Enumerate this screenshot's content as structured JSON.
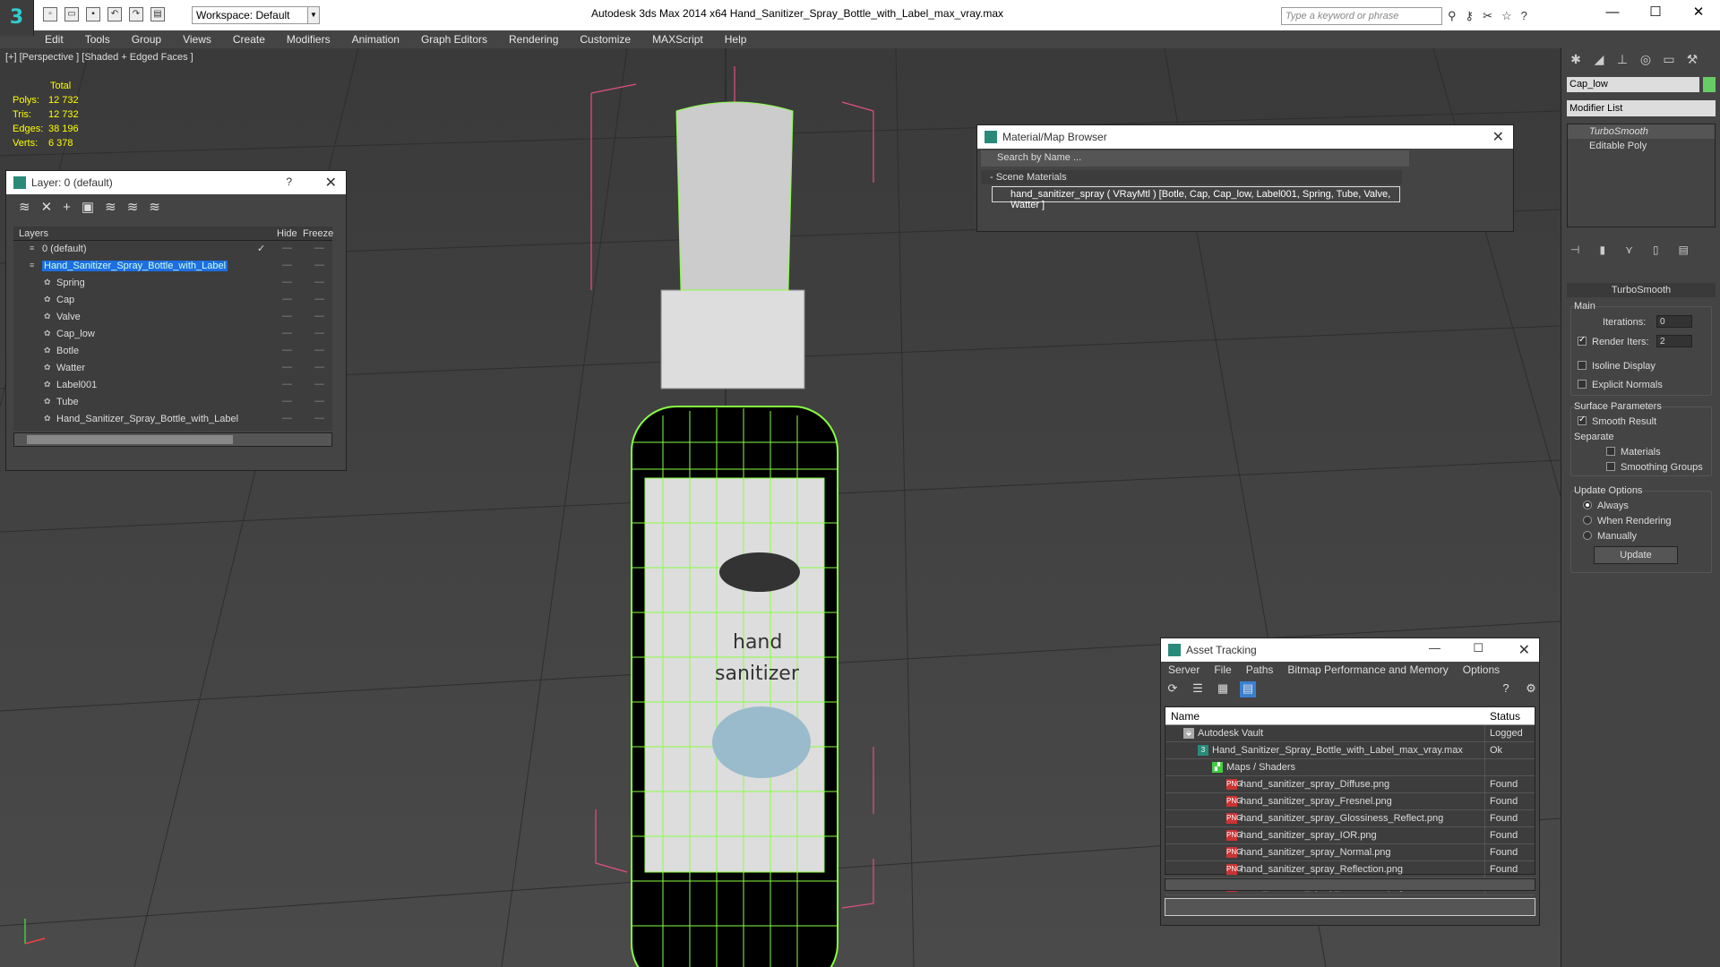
{
  "app": {
    "logo": "3",
    "title": "Autodesk 3ds Max  2014 x64      Hand_Sanitizer_Spray_Bottle_with_Label_max_vray.max",
    "workspace": "Workspace: Default",
    "search_placeholder": "Type a keyword or phrase",
    "window_controls": [
      "—",
      "☐",
      "✕"
    ]
  },
  "menu": [
    "Edit",
    "Tools",
    "Group",
    "Views",
    "Create",
    "Modifiers",
    "Animation",
    "Graph Editors",
    "Rendering",
    "Customize",
    "MAXScript",
    "Help"
  ],
  "viewport": {
    "label": "[+] [Perspective ] [Shaded + Edged Faces ]",
    "stats": {
      "header": "Total",
      "rows": [
        {
          "k": "Polys:",
          "v": "12 732"
        },
        {
          "k": "Tris:",
          "v": "12 732"
        },
        {
          "k": "Edges:",
          "v": "38 196"
        },
        {
          "k": "Verts:",
          "v": "6 378"
        }
      ]
    },
    "label_texts": [
      "hand",
      "sanitizer"
    ]
  },
  "layer_panel": {
    "title": "Layer: 0 (default)",
    "help": "?",
    "close": "✕",
    "columns": {
      "layers": "Layers",
      "hide": "Hide",
      "freeze": "Freeze"
    },
    "rows": [
      {
        "name": "0 (default)",
        "indent": 0,
        "selected": false,
        "check": true
      },
      {
        "name": "Hand_Sanitizer_Spray_Bottle_with_Label",
        "indent": 0,
        "selected": true,
        "check": false
      },
      {
        "name": "Spring",
        "indent": 1,
        "selected": false,
        "check": false
      },
      {
        "name": "Cap",
        "indent": 1,
        "selected": false,
        "check": false
      },
      {
        "name": "Valve",
        "indent": 1,
        "selected": false,
        "check": false
      },
      {
        "name": "Cap_low",
        "indent": 1,
        "selected": false,
        "check": false
      },
      {
        "name": "Botle",
        "indent": 1,
        "selected": false,
        "check": false
      },
      {
        "name": "Watter",
        "indent": 1,
        "selected": false,
        "check": false
      },
      {
        "name": "Label001",
        "indent": 1,
        "selected": false,
        "check": false
      },
      {
        "name": "Tube",
        "indent": 1,
        "selected": false,
        "check": false
      },
      {
        "name": "Hand_Sanitizer_Spray_Bottle_with_Label",
        "indent": 1,
        "selected": false,
        "check": false
      }
    ]
  },
  "material_browser": {
    "title": "Material/Map Browser",
    "close": "✕",
    "search": "Search by Name ...",
    "section": "- Scene Materials",
    "item": "hand_sanitizer_spray  ( VRayMtl ) [Botle, Cap, Cap_low, Label001, Spring, Tube, Valve, Watter ]"
  },
  "command_panel": {
    "object_name": "Cap_low",
    "object_color": "#66cc66",
    "modifier_list": "Modifier List",
    "stack": [
      "TurboSmooth",
      "Editable Poly"
    ],
    "rollout": "TurboSmooth",
    "main": "Main",
    "iterations_label": "Iterations:",
    "iterations": "0",
    "render_iters_label": "Render Iters:",
    "render_iters": "2",
    "render_iters_checked": true,
    "isoline": "Isoline Display",
    "explicit": "Explicit Normals",
    "surface": "Surface Parameters",
    "smooth_result": "Smooth Result",
    "separate": "Separate",
    "materials": "Materials",
    "smoothing_groups": "Smoothing Groups",
    "update_options": "Update Options",
    "always": "Always",
    "when_rendering": "When Rendering",
    "manually": "Manually",
    "update_btn": "Update"
  },
  "asset_tracking": {
    "title": "Asset Tracking",
    "controls": [
      "—",
      "☐",
      "✕"
    ],
    "menu": [
      "Server",
      "File",
      "Paths",
      "Bitmap Performance and Memory",
      "Options"
    ],
    "columns": {
      "name": "Name",
      "status": "Status"
    },
    "rows": [
      {
        "name": "Autodesk Vault",
        "status": "Logged",
        "indent": 1,
        "icon": "vault"
      },
      {
        "name": "Hand_Sanitizer_Spray_Bottle_with_Label_max_vray.max",
        "status": "Ok",
        "indent": 2,
        "icon": "max"
      },
      {
        "name": "Maps / Shaders",
        "status": "",
        "indent": 3,
        "icon": "maps"
      },
      {
        "name": "hand_sanitizer_spray_Diffuse.png",
        "status": "Found",
        "indent": 4,
        "icon": "png"
      },
      {
        "name": "hand_sanitizer_spray_Fresnel.png",
        "status": "Found",
        "indent": 4,
        "icon": "png"
      },
      {
        "name": "hand_sanitizer_spray_Glossiness_Reflect.png",
        "status": "Found",
        "indent": 4,
        "icon": "png"
      },
      {
        "name": "hand_sanitizer_spray_IOR.png",
        "status": "Found",
        "indent": 4,
        "icon": "png"
      },
      {
        "name": "hand_sanitizer_spray_Normal.png",
        "status": "Found",
        "indent": 4,
        "icon": "png"
      },
      {
        "name": "hand_sanitizer_spray_Reflection.png",
        "status": "Found",
        "indent": 4,
        "icon": "png"
      },
      {
        "name": "hand_sanitizer_spray_Refraction.png",
        "status": "Found",
        "indent": 4,
        "icon": "png"
      }
    ]
  }
}
